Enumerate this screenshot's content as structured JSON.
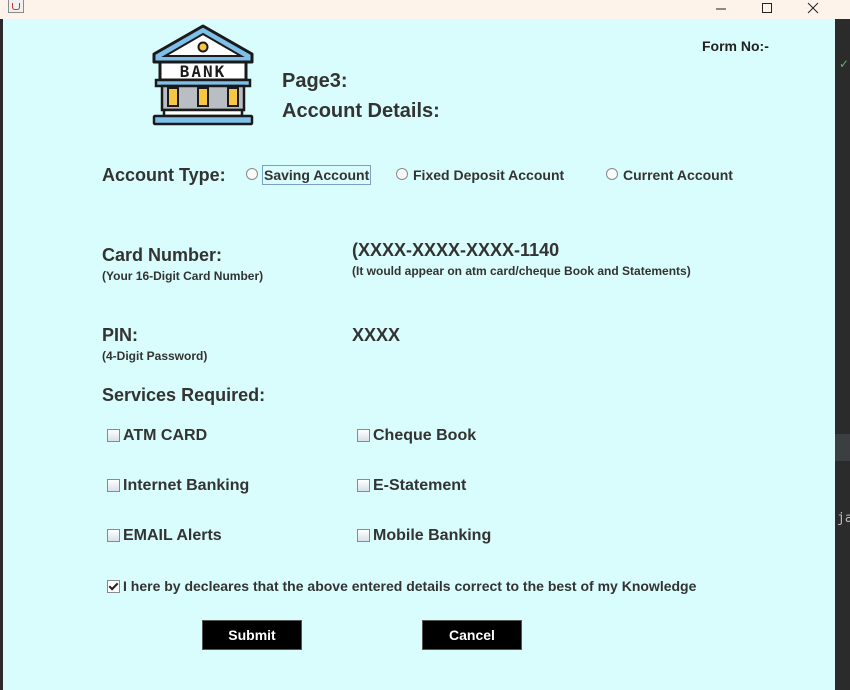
{
  "window": {
    "icon": "java-cup-icon",
    "controls": [
      "minimize-icon",
      "maximize-icon",
      "close-icon"
    ]
  },
  "header": {
    "logo_text": "BANK",
    "form_no": "Form No:-",
    "page": "Page3:",
    "title": "Account Details:"
  },
  "account_type": {
    "label": "Account Type:",
    "options": [
      "Saving Account",
      "Fixed Deposit Account",
      "Current Account"
    ],
    "focused": "Saving Account"
  },
  "card": {
    "label": "Card Number:",
    "hint": "(Your 16-Digit Card Number)",
    "value": "(XXXX-XXXX-XXXX-1140",
    "value_note": "(It would appear on atm card/cheque Book and Statements)"
  },
  "pin": {
    "label": "PIN:",
    "hint": "(4-Digit Password)",
    "value": "XXXX"
  },
  "services": {
    "label": "Services Required:",
    "items": [
      "ATM CARD",
      "Cheque Book",
      "Internet Banking",
      "E-Statement",
      "EMAIL Alerts",
      "Mobile Banking"
    ]
  },
  "declaration": {
    "text": "I here by decleares that the above entered details correct to the best of my Knowledge",
    "checked": true
  },
  "buttons": {
    "submit": "Submit",
    "cancel": "Cancel"
  },
  "colors": {
    "background": "#d9fcfc",
    "button_bg": "#000000",
    "button_text": "#ffffff",
    "titlebar": "#fdf3ea"
  }
}
